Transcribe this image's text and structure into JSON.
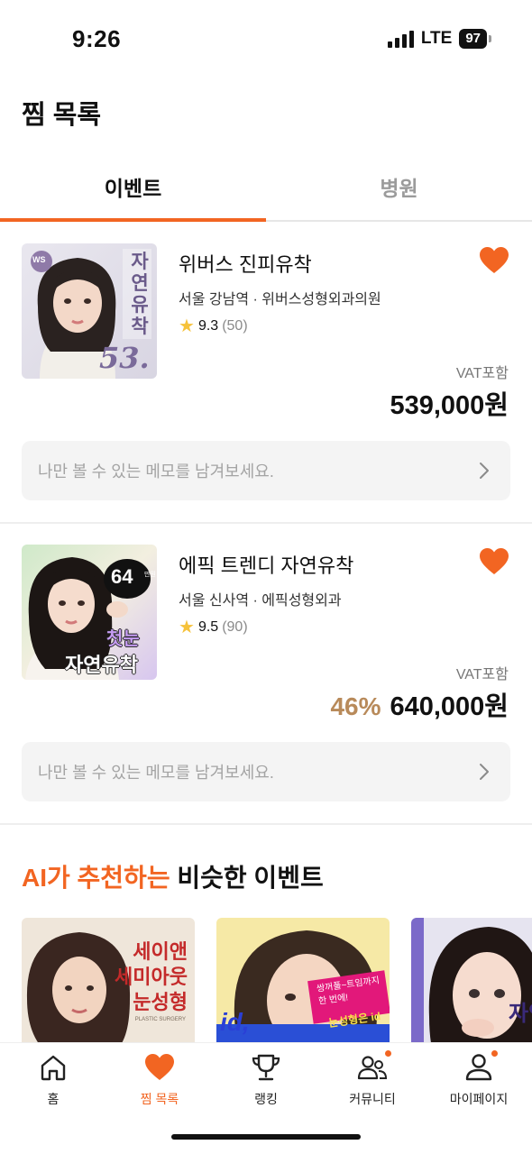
{
  "status_bar": {
    "time": "9:26",
    "network": "LTE",
    "battery": "97"
  },
  "header": {
    "title": "찜 목록"
  },
  "tabs": [
    {
      "label": "이벤트",
      "active": true
    },
    {
      "label": "병원",
      "active": false
    }
  ],
  "events": [
    {
      "title": "위버스 진피유착",
      "location": "서울 강남역 · 위버스성형외과의원",
      "rating": "9.3",
      "review_count": "(50)",
      "vat_note": "VAT포함",
      "discount": "",
      "price": "539,000원",
      "memo_placeholder": "나만 볼 수 있는 메모를 남겨보세요.",
      "thumb": {
        "badge_text": "자연유착",
        "number": "53.",
        "logo": "WS"
      }
    },
    {
      "title": "에픽 트렌디 자연유착",
      "location": "서울 신사역 · 에픽성형외과",
      "rating": "9.5",
      "review_count": "(90)",
      "vat_note": "VAT포함",
      "discount": "46%",
      "price": "640,000원",
      "memo_placeholder": "나만 볼 수 있는 메모를 남겨보세요.",
      "thumb": {
        "number": "64",
        "unit": "만원",
        "line1": "첫눈",
        "line2": "자연유착"
      }
    }
  ],
  "recommendation": {
    "title_accent": "AI가 추천하는",
    "title_rest": " 비슷한 이벤트",
    "items": [
      {
        "line1": "세이앤",
        "line2": "세미아웃",
        "line3": "눈성형",
        "caption": "PLASTIC SURGERY"
      },
      {
        "line1": "쌍꺼풀~트임까지",
        "line2": "한 번에!",
        "line3": "눈성형은 id",
        "brand": "id,"
      },
      {
        "line1": "자연"
      }
    ]
  },
  "bottom_nav": [
    {
      "label": "홈",
      "icon": "home-icon",
      "active": false,
      "badge": false
    },
    {
      "label": "찜 목록",
      "icon": "heart-icon",
      "active": true,
      "badge": false
    },
    {
      "label": "랭킹",
      "icon": "trophy-icon",
      "active": false,
      "badge": false
    },
    {
      "label": "커뮤니티",
      "icon": "people-icon",
      "active": false,
      "badge": true
    },
    {
      "label": "마이페이지",
      "icon": "person-icon",
      "active": false,
      "badge": true
    }
  ],
  "colors": {
    "accent": "#f26522",
    "discount": "#b88a5a",
    "star": "#f6c23a"
  }
}
